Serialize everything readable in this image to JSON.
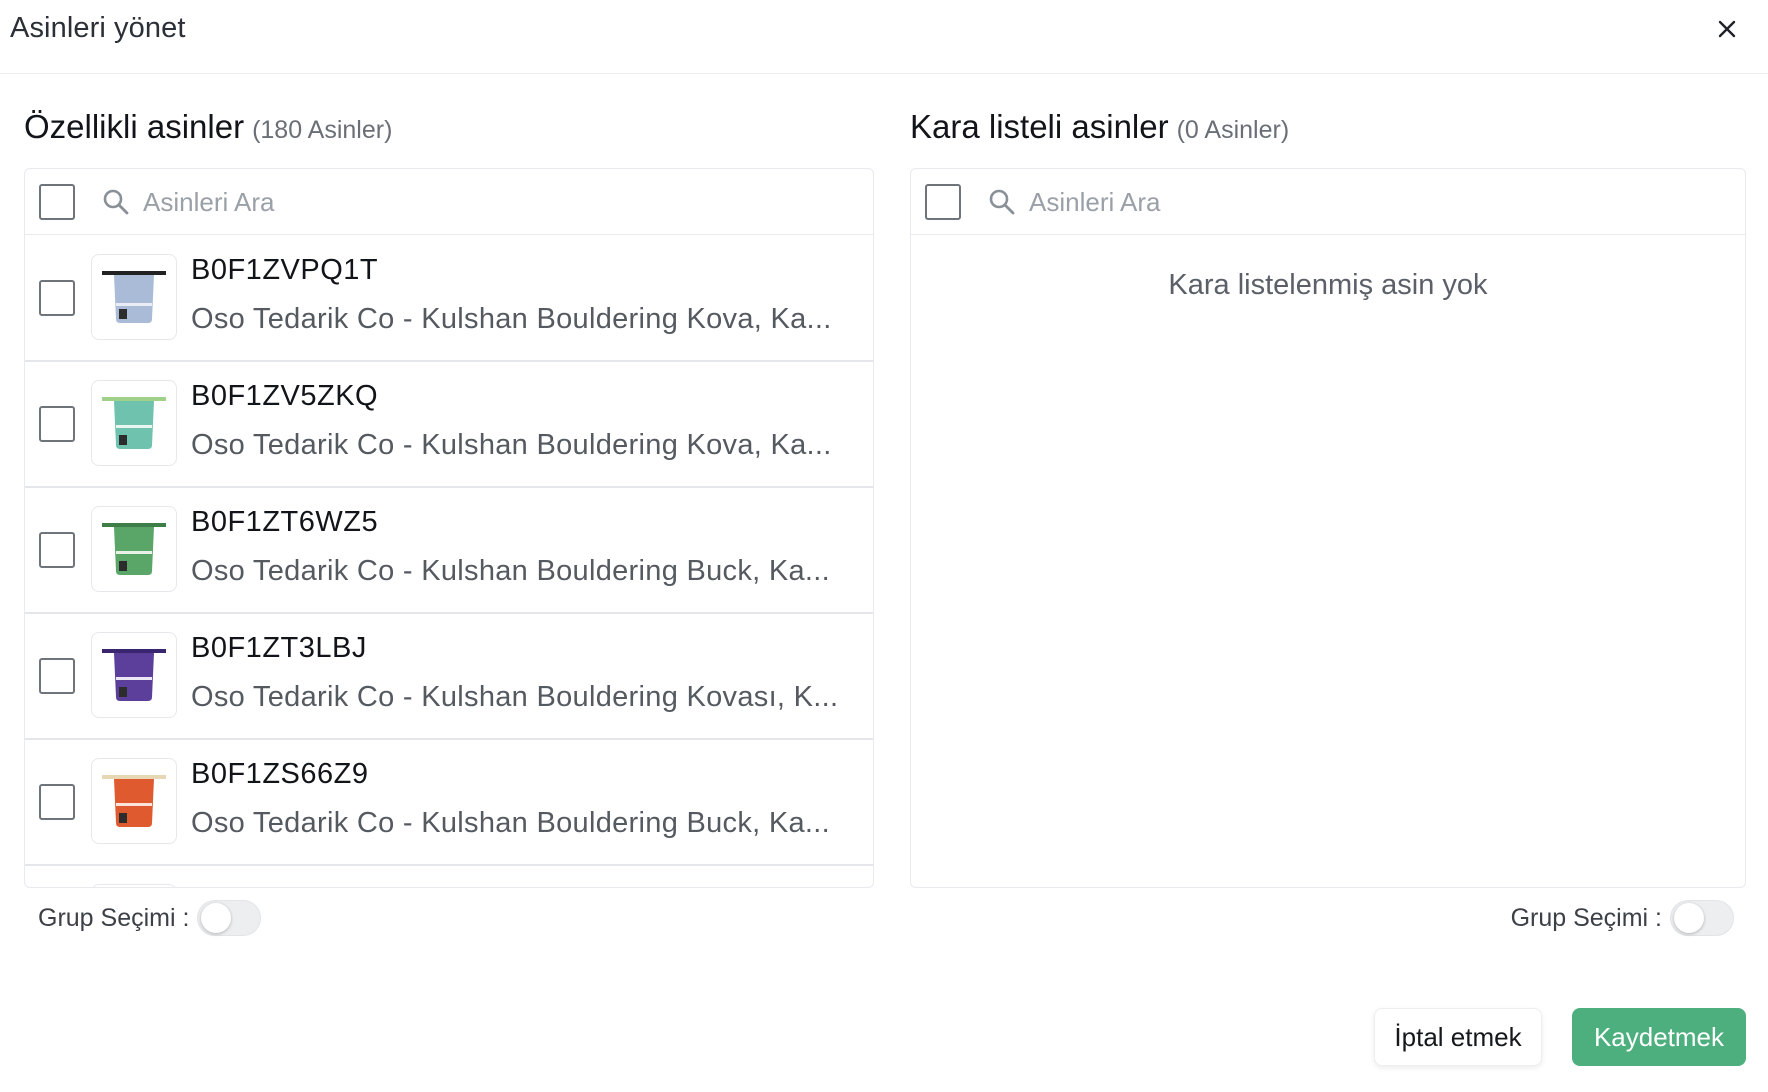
{
  "modal": {
    "title": "Asinleri yönet",
    "close_icon": "close-icon"
  },
  "featured": {
    "title": "Özellikli asinler",
    "count": "(180 Asinler)",
    "search_placeholder": "Asinleri Ara",
    "items": [
      {
        "asin": "B0F1ZVPQ1T",
        "title": "Oso Tedarik Co - Kulshan Bouldering Kova, Ka...",
        "color": "#a9bbd6"
      },
      {
        "asin": "B0F1ZV5ZKQ",
        "title": "Oso Tedarik Co - Kulshan Bouldering Kova, Ka...",
        "color": "#6fc2ad"
      },
      {
        "asin": "B0F1ZT6WZ5",
        "title": "Oso Tedarik Co - Kulshan Bouldering Buck, Ka...",
        "color": "#5aa568"
      },
      {
        "asin": "B0F1ZT3LBJ",
        "title": "Oso Tedarik Co - Kulshan Bouldering Kovası, K...",
        "color": "#5b3f9a"
      },
      {
        "asin": "B0F1ZS66Z9",
        "title": "Oso Tedarik Co - Kulshan Bouldering Buck, Ka...",
        "color": "#e05a30"
      }
    ],
    "group_select_label": "Grup Seçimi :"
  },
  "blacklisted": {
    "title": "Kara listeli asinler",
    "count": "(0 Asinler)",
    "search_placeholder": "Asinleri Ara",
    "empty_message": "Kara listelenmiş asin yok",
    "group_select_label": "Grup Seçimi :"
  },
  "footer": {
    "cancel_label": "İptal etmek",
    "save_label": "Kaydetmek"
  },
  "colors": {
    "primary": "#4caf7d",
    "border": "#e8eaed"
  }
}
